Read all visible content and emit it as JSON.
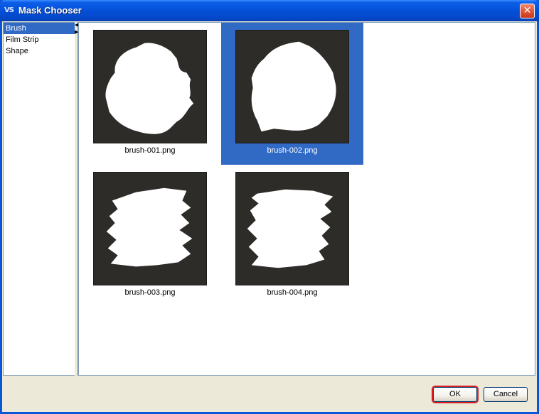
{
  "window": {
    "title": "Mask Chooser",
    "app_icon_text": "VS",
    "close_glyph": "✕"
  },
  "categories": [
    {
      "label": "Brush",
      "selected": true
    },
    {
      "label": "Film Strip",
      "selected": false
    },
    {
      "label": "Shape",
      "selected": false
    }
  ],
  "masks": [
    {
      "label": "brush-001.png",
      "selected": false,
      "icon": "brush-mask-round"
    },
    {
      "label": "brush-002.png",
      "selected": true,
      "icon": "brush-mask-blob"
    },
    {
      "label": "brush-003.png",
      "selected": false,
      "icon": "brush-mask-streaks"
    },
    {
      "label": "brush-004.png",
      "selected": false,
      "icon": "brush-mask-streaks-2"
    }
  ],
  "buttons": {
    "ok": "OK",
    "cancel": "Cancel"
  },
  "colors": {
    "title_bar": "#0550d8",
    "selection": "#316ac5",
    "highlight_outline": "#d81f1f",
    "thumb_background": "#2e2c29"
  }
}
